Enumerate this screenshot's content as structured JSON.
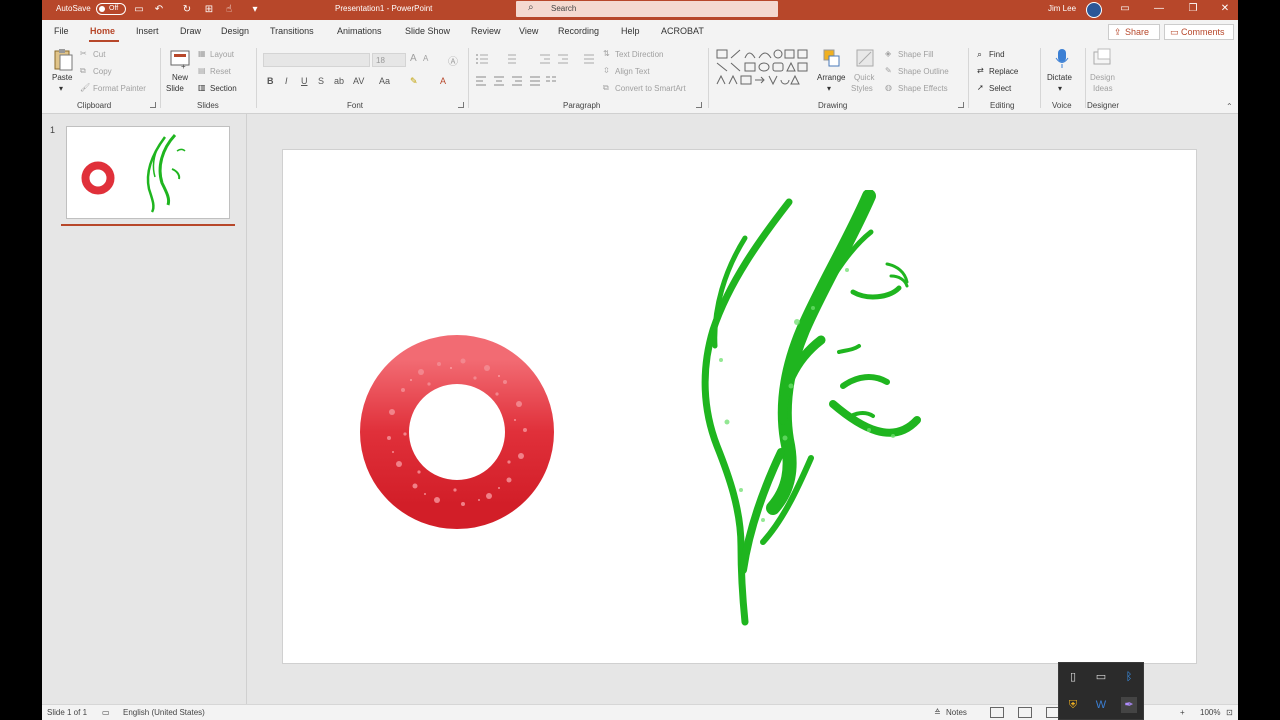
{
  "titlebar": {
    "autosave_label": "AutoSave",
    "autosave_state": "Off",
    "document_title": "Presentation1  -  PowerPoint",
    "search_placeholder": "Search",
    "user_name": "Jim Lee"
  },
  "tabs": [
    "File",
    "Home",
    "Insert",
    "Draw",
    "Design",
    "Transitions",
    "Animations",
    "Slide Show",
    "Review",
    "View",
    "Recording",
    "Help",
    "ACROBAT"
  ],
  "active_tab": "Home",
  "actions": {
    "share": "Share",
    "comments": "Comments"
  },
  "ribbon": {
    "clipboard": {
      "paste": "Paste",
      "cut": "Cut",
      "copy": "Copy",
      "format_painter": "Format Painter",
      "label": "Clipboard"
    },
    "slides": {
      "new_slide": "New",
      "new_slide_2": "Slide",
      "layout": "Layout",
      "reset": "Reset",
      "section": "Section",
      "label": "Slides"
    },
    "font": {
      "size": "18",
      "label": "Font"
    },
    "paragraph": {
      "text_direction": "Text Direction",
      "align_text": "Align Text",
      "convert_smartart": "Convert to SmartArt",
      "label": "Paragraph"
    },
    "drawing": {
      "arrange": "Arrange",
      "quick_styles": "Quick",
      "quick_styles_2": "Styles",
      "shape_fill": "Shape Fill",
      "shape_outline": "Shape Outline",
      "shape_effects": "Shape Effects",
      "label": "Drawing"
    },
    "editing": {
      "find": "Find",
      "replace": "Replace",
      "select": "Select",
      "label": "Editing"
    },
    "voice": {
      "dictate": "Dictate",
      "label": "Voice"
    },
    "designer": {
      "design_ideas": "Design",
      "design_ideas_2": "Ideas",
      "label": "Designer"
    }
  },
  "thumbnails": {
    "slide_number": "1"
  },
  "statusbar": {
    "slide_info": "Slide 1 of 1",
    "language": "English (United States)",
    "notes": "Notes",
    "zoom": "100%"
  },
  "colors": {
    "accent": "#b7472a",
    "ring_red": "#e0303a",
    "face_green": "#1fb51f"
  }
}
